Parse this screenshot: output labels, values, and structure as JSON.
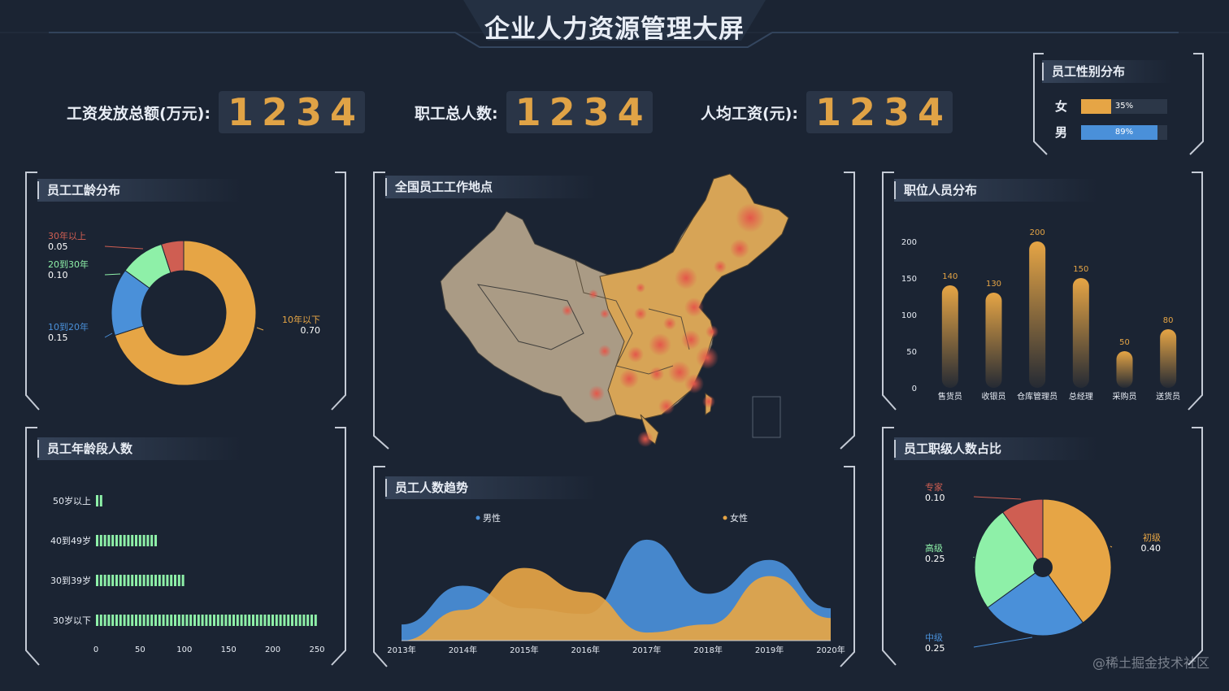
{
  "page": {
    "title": "企业人力资源管理大屏",
    "watermark": "@稀土掘金技术社区"
  },
  "stats": [
    {
      "label": "工资发放总额(万元):",
      "digits": [
        "1",
        "2",
        "3",
        "4"
      ]
    },
    {
      "label": "职工总人数:",
      "digits": [
        "1",
        "2",
        "3",
        "4"
      ]
    },
    {
      "label": "人均工资(元):",
      "digits": [
        "1",
        "2",
        "3",
        "4"
      ]
    }
  ],
  "colors": {
    "orange": "#e6a545",
    "blue": "#4a90d9",
    "green": "#8ef0a8",
    "red": "#cf5e52",
    "bg": "#1b2433"
  },
  "gender": {
    "title": "员工性别分布",
    "items": [
      {
        "label": "女",
        "value": "35%",
        "fraction": 0.35,
        "color": "#e6a545"
      },
      {
        "label": "男",
        "value": "89%",
        "fraction": 0.89,
        "color": "#4a90d9"
      }
    ]
  },
  "panels": {
    "seniority": "员工工龄分布",
    "map": "全国员工工作地点",
    "positions": "职位人员分布",
    "age": "员工年龄段人数",
    "trend": "员工人数趋势",
    "level": "员工职级人数占比"
  },
  "chart_data": [
    {
      "type": "pie",
      "title": "员工工龄分布",
      "slices": [
        {
          "name": "10年以下",
          "value": 0.7,
          "label": "0.70",
          "color": "#e6a545"
        },
        {
          "name": "10到20年",
          "value": 0.15,
          "label": "0.15",
          "color": "#4a90d9"
        },
        {
          "name": "20到30年",
          "value": 0.1,
          "label": "0.10",
          "color": "#8ef0a8"
        },
        {
          "name": "30年以上",
          "value": 0.05,
          "label": "0.05",
          "color": "#cf5e52"
        }
      ]
    },
    {
      "type": "bar",
      "title": "职位人员分布",
      "categories": [
        "售货员",
        "收银员",
        "仓库管理员",
        "总经理",
        "采购员",
        "送货员"
      ],
      "values": [
        140,
        130,
        200,
        150,
        50,
        80
      ],
      "yticks": [
        0,
        50,
        100,
        150,
        200
      ],
      "ylim": [
        0,
        200
      ]
    },
    {
      "type": "bar",
      "title": "员工年龄段人数",
      "orientation": "horizontal",
      "categories": [
        "50岁以上",
        "40到49岁",
        "30到39岁",
        "30岁以下"
      ],
      "values": [
        10,
        70,
        100,
        250
      ],
      "xticks": [
        0,
        50,
        100,
        150,
        200,
        250
      ],
      "xlim": [
        0,
        250
      ]
    },
    {
      "type": "area",
      "title": "员工人数趋势",
      "categories": [
        "2013年",
        "2014年",
        "2015年",
        "2016年",
        "2017年",
        "2018年",
        "2019年",
        "2020年"
      ],
      "series": [
        {
          "name": "男性",
          "values": [
            20,
            68,
            40,
            33,
            125,
            58,
            100,
            40
          ],
          "color": "#4a90d9"
        },
        {
          "name": "女性",
          "values": [
            0,
            38,
            90,
            60,
            10,
            20,
            80,
            28
          ],
          "color": "#e6a545"
        }
      ],
      "ylim": [
        0,
        135
      ]
    },
    {
      "type": "pie",
      "title": "员工职级人数占比",
      "slices": [
        {
          "name": "初级",
          "value": 0.4,
          "label": "0.40",
          "color": "#e6a545"
        },
        {
          "name": "中级",
          "value": 0.25,
          "label": "0.25",
          "color": "#4a90d9"
        },
        {
          "name": "高级",
          "value": 0.25,
          "label": "0.25",
          "color": "#8ef0a8"
        },
        {
          "name": "专家",
          "value": 0.1,
          "label": "0.10",
          "color": "#cf5e52"
        }
      ]
    }
  ]
}
